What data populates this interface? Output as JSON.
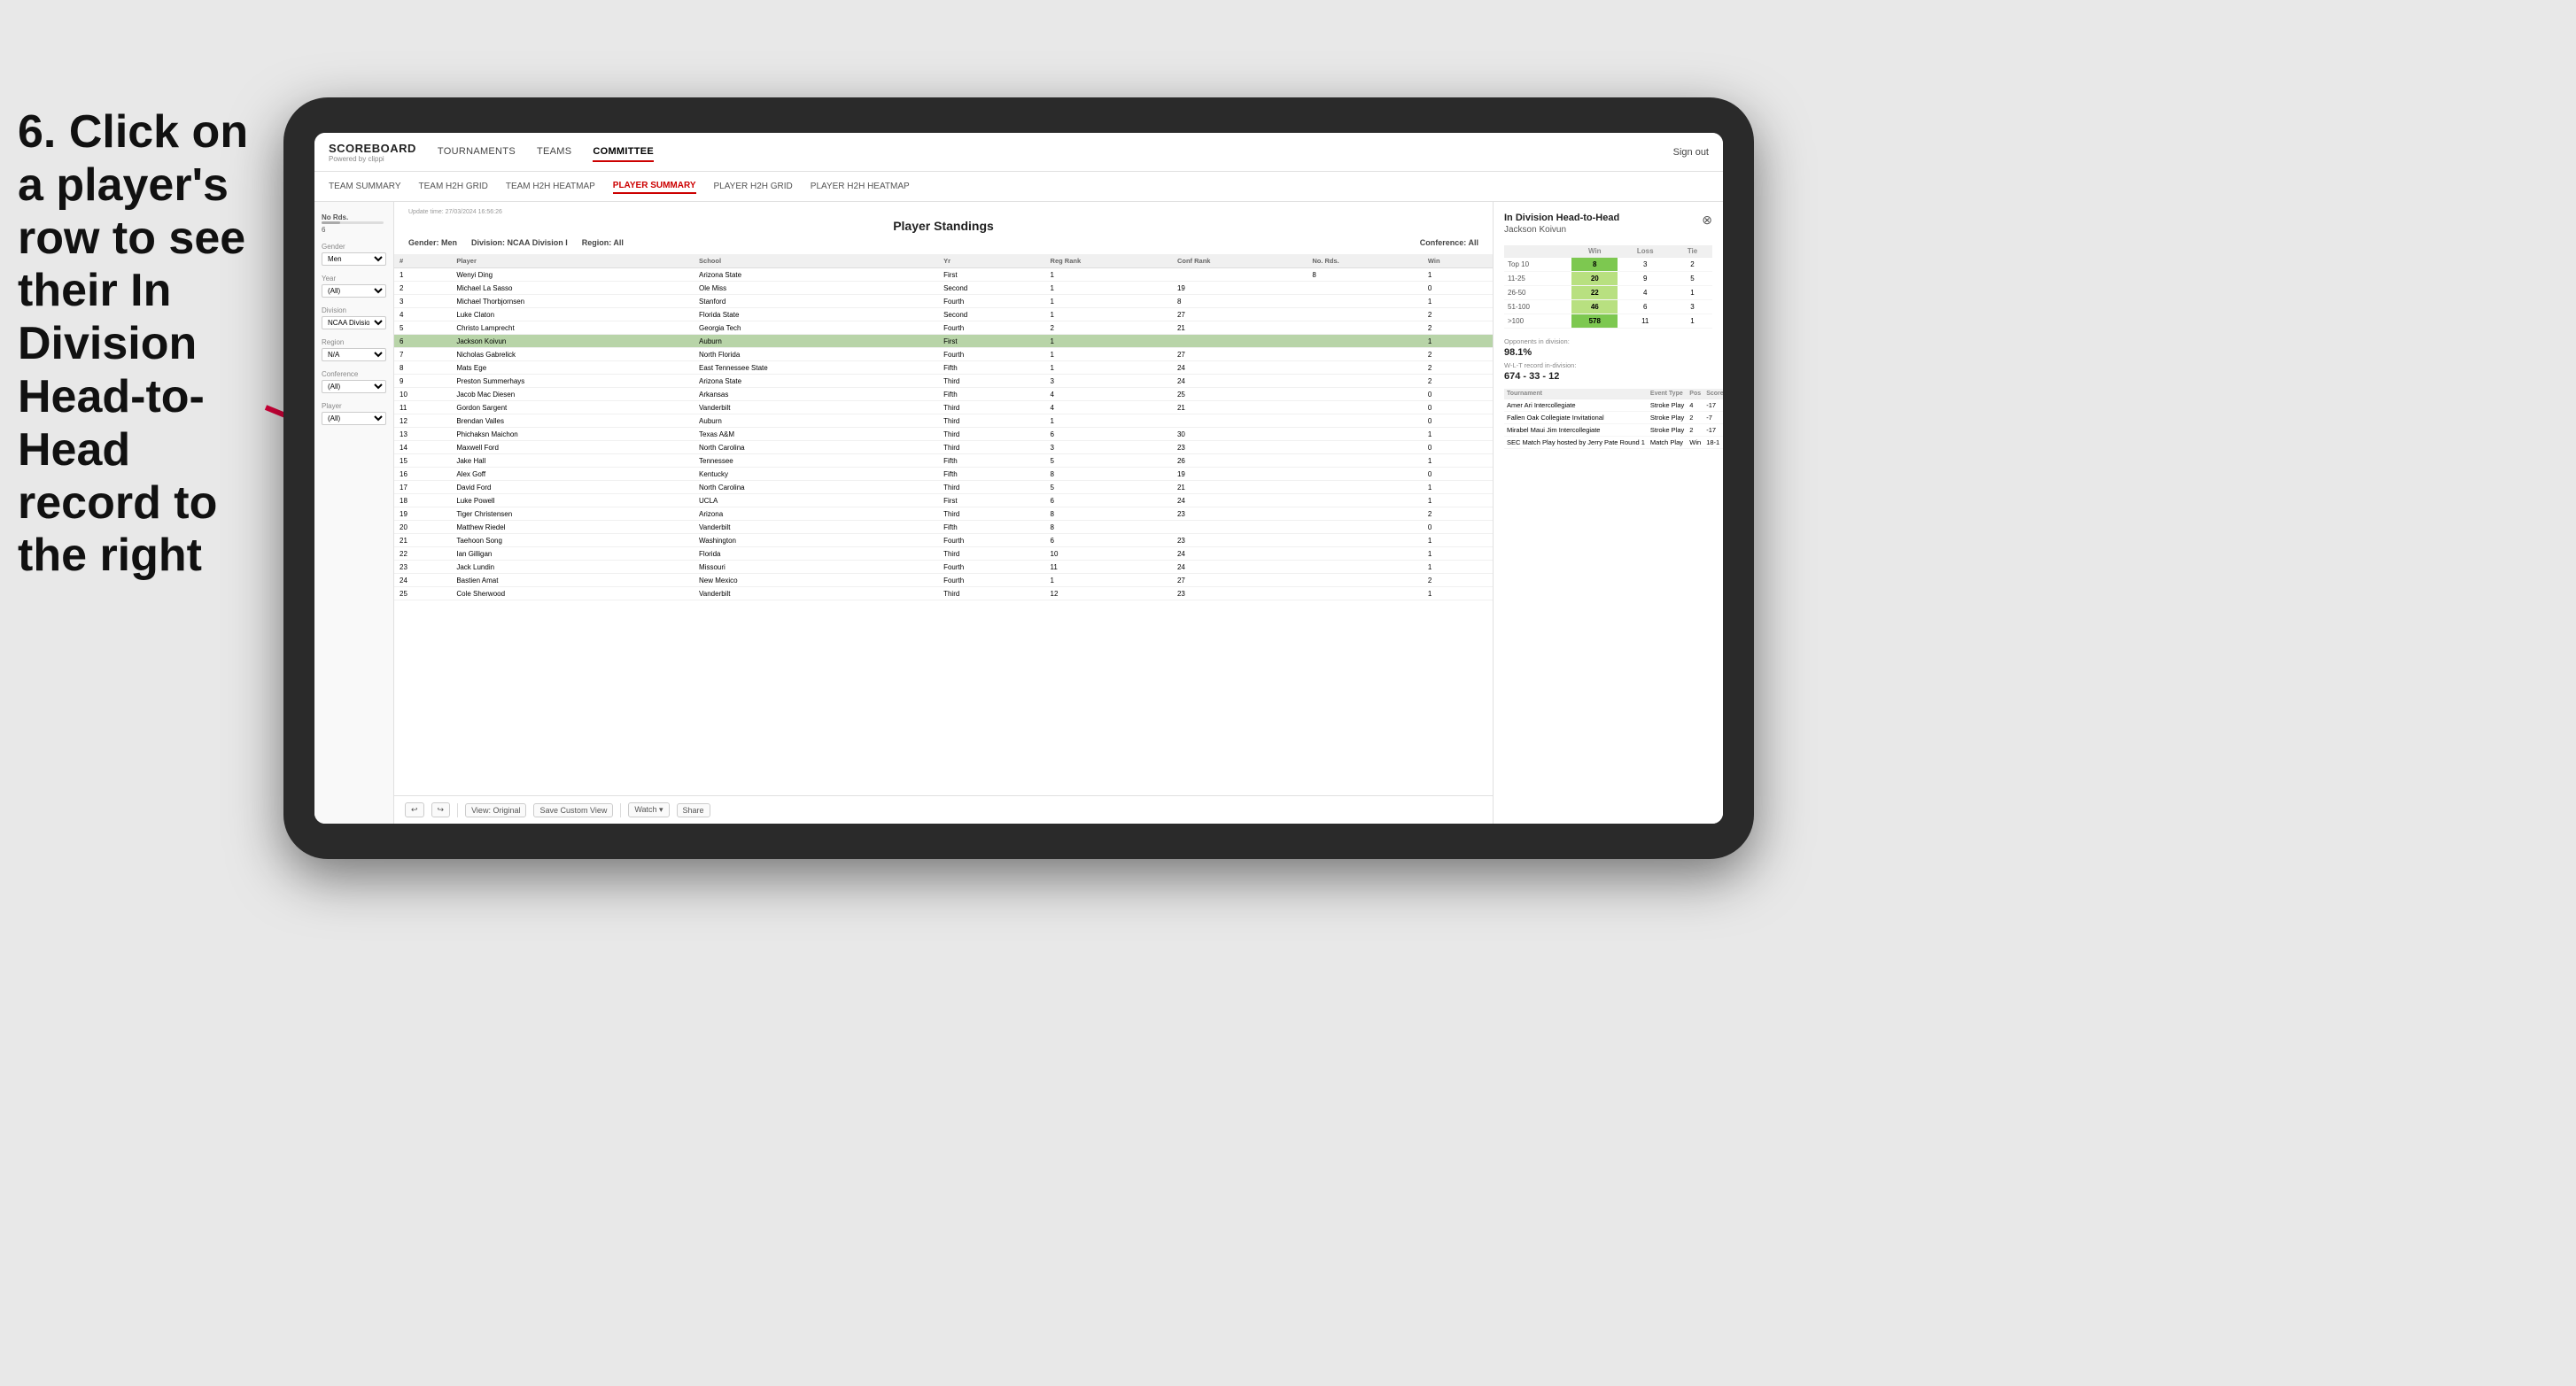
{
  "instruction": {
    "text": "6. Click on a player's row to see their In Division Head-to-Head record to the right"
  },
  "nav": {
    "logo": "SCOREBOARD",
    "powered_by": "Powered by clippi",
    "items": [
      "TOURNAMENTS",
      "TEAMS",
      "COMMITTEE"
    ],
    "sign_out": "Sign out"
  },
  "sub_nav": {
    "items": [
      "TEAM SUMMARY",
      "TEAM H2H GRID",
      "TEAM H2H HEATMAP",
      "PLAYER SUMMARY",
      "PLAYER H2H GRID",
      "PLAYER H2H HEATMAP"
    ],
    "active": "PLAYER SUMMARY"
  },
  "filters": {
    "no_rds_label": "No Rds.",
    "no_rds_value": "6",
    "gender_label": "Gender",
    "gender_value": "Men",
    "year_label": "Year",
    "year_value": "(All)",
    "division_label": "Division",
    "division_value": "NCAA Division I",
    "region_label": "Region",
    "region_value": "N/A",
    "conference_label": "Conference",
    "conference_value": "(All)",
    "player_label": "Player",
    "player_value": "(All)"
  },
  "standings": {
    "title": "Player Standings",
    "update_time": "Update time: 27/03/2024 16:56:26",
    "gender": "Men",
    "division": "NCAA Division I",
    "region": "All",
    "conference": "All",
    "columns": [
      "#",
      "Player",
      "School",
      "Yr",
      "Reg Rank",
      "Conf Rank",
      "No. Rds.",
      "Win"
    ],
    "rows": [
      {
        "num": "1",
        "player": "Wenyi Ding",
        "school": "Arizona State",
        "yr": "First",
        "reg": "1",
        "conf": "",
        "rds": "8",
        "win": "1"
      },
      {
        "num": "2",
        "player": "Michael La Sasso",
        "school": "Ole Miss",
        "yr": "Second",
        "reg": "1",
        "conf": "19",
        "rds": "",
        "win": "0"
      },
      {
        "num": "3",
        "player": "Michael Thorbjornsen",
        "school": "Stanford",
        "yr": "Fourth",
        "reg": "1",
        "conf": "8",
        "rds": "",
        "win": "1"
      },
      {
        "num": "4",
        "player": "Luke Claton",
        "school": "Florida State",
        "yr": "Second",
        "reg": "1",
        "conf": "27",
        "rds": "",
        "win": "2"
      },
      {
        "num": "5",
        "player": "Christo Lamprecht",
        "school": "Georgia Tech",
        "yr": "Fourth",
        "reg": "2",
        "conf": "21",
        "rds": "",
        "win": "2"
      },
      {
        "num": "6",
        "player": "Jackson Koivun",
        "school": "Auburn",
        "yr": "First",
        "reg": "1",
        "conf": "",
        "rds": "",
        "win": "1",
        "highlighted": true
      },
      {
        "num": "7",
        "player": "Nicholas Gabrelick",
        "school": "North Florida",
        "yr": "Fourth",
        "reg": "1",
        "conf": "27",
        "rds": "",
        "win": "2"
      },
      {
        "num": "8",
        "player": "Mats Ege",
        "school": "East Tennessee State",
        "yr": "Fifth",
        "reg": "1",
        "conf": "24",
        "rds": "",
        "win": "2"
      },
      {
        "num": "9",
        "player": "Preston Summerhays",
        "school": "Arizona State",
        "yr": "Third",
        "reg": "3",
        "conf": "24",
        "rds": "",
        "win": "2"
      },
      {
        "num": "10",
        "player": "Jacob Mac Diesen",
        "school": "Arkansas",
        "yr": "Fifth",
        "reg": "4",
        "conf": "25",
        "rds": "",
        "win": "0"
      },
      {
        "num": "11",
        "player": "Gordon Sargent",
        "school": "Vanderbilt",
        "yr": "Third",
        "reg": "4",
        "conf": "21",
        "rds": "",
        "win": "0"
      },
      {
        "num": "12",
        "player": "Brendan Valles",
        "school": "Auburn",
        "yr": "Third",
        "reg": "1",
        "conf": "",
        "rds": "",
        "win": "0"
      },
      {
        "num": "13",
        "player": "Phichaksn Maichon",
        "school": "Texas A&M",
        "yr": "Third",
        "reg": "6",
        "conf": "30",
        "rds": "",
        "win": "1"
      },
      {
        "num": "14",
        "player": "Maxwell Ford",
        "school": "North Carolina",
        "yr": "Third",
        "reg": "3",
        "conf": "23",
        "rds": "",
        "win": "0"
      },
      {
        "num": "15",
        "player": "Jake Hall",
        "school": "Tennessee",
        "yr": "Fifth",
        "reg": "5",
        "conf": "26",
        "rds": "",
        "win": "1"
      },
      {
        "num": "16",
        "player": "Alex Goff",
        "school": "Kentucky",
        "yr": "Fifth",
        "reg": "8",
        "conf": "19",
        "rds": "",
        "win": "0"
      },
      {
        "num": "17",
        "player": "David Ford",
        "school": "North Carolina",
        "yr": "Third",
        "reg": "5",
        "conf": "21",
        "rds": "",
        "win": "1"
      },
      {
        "num": "18",
        "player": "Luke Powell",
        "school": "UCLA",
        "yr": "First",
        "reg": "6",
        "conf": "24",
        "rds": "",
        "win": "1"
      },
      {
        "num": "19",
        "player": "Tiger Christensen",
        "school": "Arizona",
        "yr": "Third",
        "reg": "8",
        "conf": "23",
        "rds": "",
        "win": "2"
      },
      {
        "num": "20",
        "player": "Matthew Riedel",
        "school": "Vanderbilt",
        "yr": "Fifth",
        "reg": "8",
        "conf": "",
        "rds": "",
        "win": "0"
      },
      {
        "num": "21",
        "player": "Taehoon Song",
        "school": "Washington",
        "yr": "Fourth",
        "reg": "6",
        "conf": "23",
        "rds": "",
        "win": "1"
      },
      {
        "num": "22",
        "player": "Ian Gilligan",
        "school": "Florida",
        "yr": "Third",
        "reg": "10",
        "conf": "24",
        "rds": "",
        "win": "1"
      },
      {
        "num": "23",
        "player": "Jack Lundin",
        "school": "Missouri",
        "yr": "Fourth",
        "reg": "11",
        "conf": "24",
        "rds": "",
        "win": "1"
      },
      {
        "num": "24",
        "player": "Bastien Amat",
        "school": "New Mexico",
        "yr": "Fourth",
        "reg": "1",
        "conf": "27",
        "rds": "",
        "win": "2"
      },
      {
        "num": "25",
        "player": "Cole Sherwood",
        "school": "Vanderbilt",
        "yr": "Third",
        "reg": "12",
        "conf": "23",
        "rds": "",
        "win": "1"
      }
    ]
  },
  "h2h": {
    "title": "In Division Head-to-Head",
    "player": "Jackson Koivun",
    "table_headers": [
      "",
      "Win",
      "Loss",
      "Tie"
    ],
    "rows": [
      {
        "label": "Top 10",
        "win": "8",
        "loss": "3",
        "tie": "2",
        "win_color": "green"
      },
      {
        "label": "11-25",
        "win": "20",
        "loss": "9",
        "tie": "5",
        "win_color": "lightgreen"
      },
      {
        "label": "26-50",
        "win": "22",
        "loss": "4",
        "tie": "1",
        "win_color": "lightgreen"
      },
      {
        "label": "51-100",
        "win": "46",
        "loss": "6",
        "tie": "3",
        "win_color": "lightgreen"
      },
      {
        "label": ">100",
        "win": "578",
        "loss": "11",
        "tie": "1",
        "win_color": "green"
      }
    ],
    "opponents_label": "Opponents in division:",
    "wlt_label": "W-L-T record in-division:",
    "opponents_pct": "98.1%",
    "wlt_record": "674 - 33 - 12",
    "tournament_headers": [
      "Tournament",
      "Event Type",
      "Pos",
      "Score"
    ],
    "tournaments": [
      {
        "name": "Amer Ari Intercollegiate",
        "type": "Stroke Play",
        "pos": "4",
        "score": "-17"
      },
      {
        "name": "Fallen Oak Collegiate Invitational",
        "type": "Stroke Play",
        "pos": "2",
        "score": "-7"
      },
      {
        "name": "Mirabel Maui Jim Intercollegiate",
        "type": "Stroke Play",
        "pos": "2",
        "score": "-17"
      },
      {
        "name": "SEC Match Play hosted by Jerry Pate Round 1",
        "type": "Match Play",
        "pos": "Win",
        "score": "18-1"
      }
    ]
  },
  "toolbar": {
    "view_original": "View: Original",
    "save_custom": "Save Custom View",
    "watch": "Watch ▾",
    "share": "Share"
  }
}
